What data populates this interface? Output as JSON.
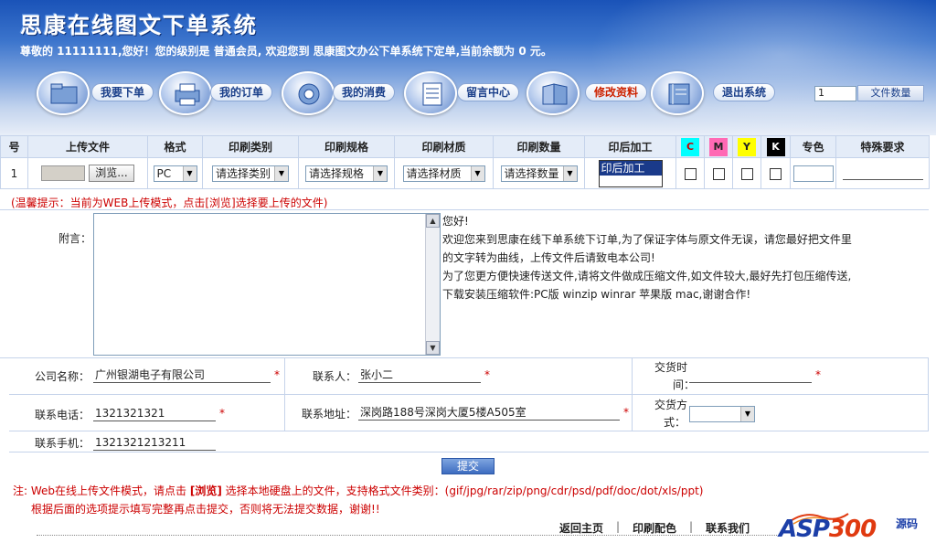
{
  "header": {
    "title": "思康在线图文下单系统",
    "welcome": "尊敬的 11111111,您好！您的级别是 普通会员, 欢迎您到 思康图文办公下单系统下定单,当前余额为 0 元。"
  },
  "nav": {
    "items": [
      {
        "label": "我要下单",
        "icon": "folder-icon"
      },
      {
        "label": "我的订单",
        "icon": "printer-icon"
      },
      {
        "label": "我的消费",
        "icon": "tape-icon"
      },
      {
        "label": "留言中心",
        "icon": "document-icon"
      },
      {
        "label": "修改资料",
        "icon": "book-icon"
      },
      {
        "label": "退出系统",
        "icon": "notebook-icon"
      }
    ],
    "page_value": "1",
    "page_label": "文件数量"
  },
  "table": {
    "headers": [
      "号",
      "上传文件",
      "格式",
      "印刷类别",
      "印刷规格",
      "印刷材质",
      "印刷数量",
      "印后加工",
      "C",
      "M",
      "Y",
      "K",
      "专色",
      "特殊要求"
    ],
    "row": {
      "index": "1",
      "browse": "浏览...",
      "format": "PC",
      "category": "请选择类别",
      "spec": "请选择规格",
      "material": "请选择材质",
      "quantity": "请选择数量",
      "postpress": "印后加工"
    }
  },
  "hint": "(温馨提示：当前为WEB上传模式，点击[浏览]选择要上传的文件)",
  "note": {
    "label": "附言：",
    "notice_lines": [
      "您好!",
      "欢迎您来到思康在线下单系统下订单,为了保证字体与原文件无误，请您最好把文件里",
      "的文字转为曲线，上传文件后请致电本公司!",
      "为了您更方便快速传送文件,请将文件做成压缩文件,如文件较大,最好先打包压缩传送,",
      "下载安装压缩软件:PC版 winzip winrar 苹果版 mac,谢谢合作!"
    ]
  },
  "contact": {
    "company_label": "公司名称：",
    "company_value": "广州银湖电子有限公司",
    "person_label": "联系人：",
    "person_value": "张小二",
    "delivery_time_label": "交货时间：",
    "delivery_time_label_a": "交货时",
    "delivery_time_label_b": "间：",
    "phone_label": "联系电话：",
    "phone_value": "1321321321",
    "address_label": "联系地址：",
    "address_value": "深岗路188号深岗大厦5楼A505室",
    "delivery_method_label_a": "交货方",
    "delivery_method_label_b": "式：",
    "mobile_label": "联系手机：",
    "mobile_value": "1321321213211",
    "required_mark": "*"
  },
  "submit_label": "提交",
  "notes": {
    "line1_prefix": "注: Web在线上传文件模式，请点击 ",
    "line1_bold": "[浏览]",
    "line1_suffix": " 选择本地硬盘上的文件，支持格式文件类别：(gif/jpg/rar/zip/png/cdr/psd/pdf/doc/dot/xls/ppt)",
    "line2": "根据后面的选项提示填写完整再点击提交，否则将无法提交数据，谢谢!!"
  },
  "footer": {
    "links": [
      "返回主页",
      "印刷配色",
      "联系我们"
    ],
    "separator": "|",
    "logo_main": "ASP",
    "logo_num": "300",
    "logo_cn": "源码"
  },
  "colors": {
    "C": "#00ffff",
    "M": "#ff69b4",
    "Y": "#ffff00",
    "K": "#000000"
  }
}
